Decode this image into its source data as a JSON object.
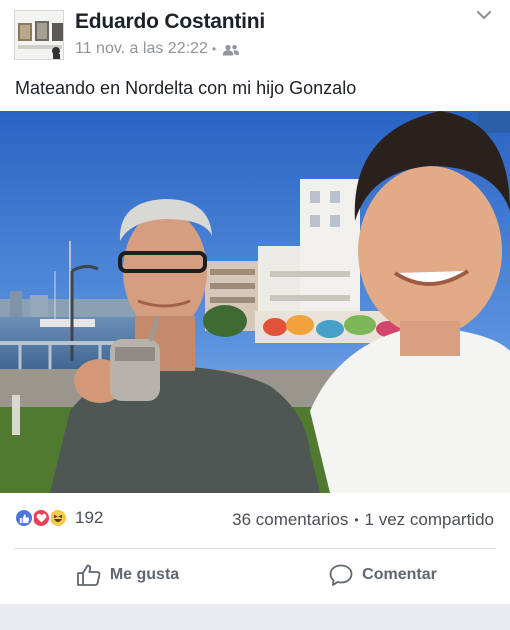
{
  "post": {
    "author": "Eduardo Costantini",
    "timestamp": "11 nov. a las 22:22",
    "separator": "•",
    "audience_icon": "friends-icon",
    "caption": "Mateando en Nordelta con mi hijo Gonzalo"
  },
  "stats": {
    "reactions": [
      "like",
      "love",
      "haha"
    ],
    "reaction_count": "192",
    "comments": "36 comentarios",
    "separator": "•",
    "shares": "1 vez compartido"
  },
  "actions": {
    "like_label": "Me gusta",
    "comment_label": "Comentar"
  },
  "colors": {
    "like": "#4a76d6",
    "love": "#e94054",
    "haha": "#f7c94b",
    "muted_text": "#90949c",
    "action_text": "#606770"
  }
}
